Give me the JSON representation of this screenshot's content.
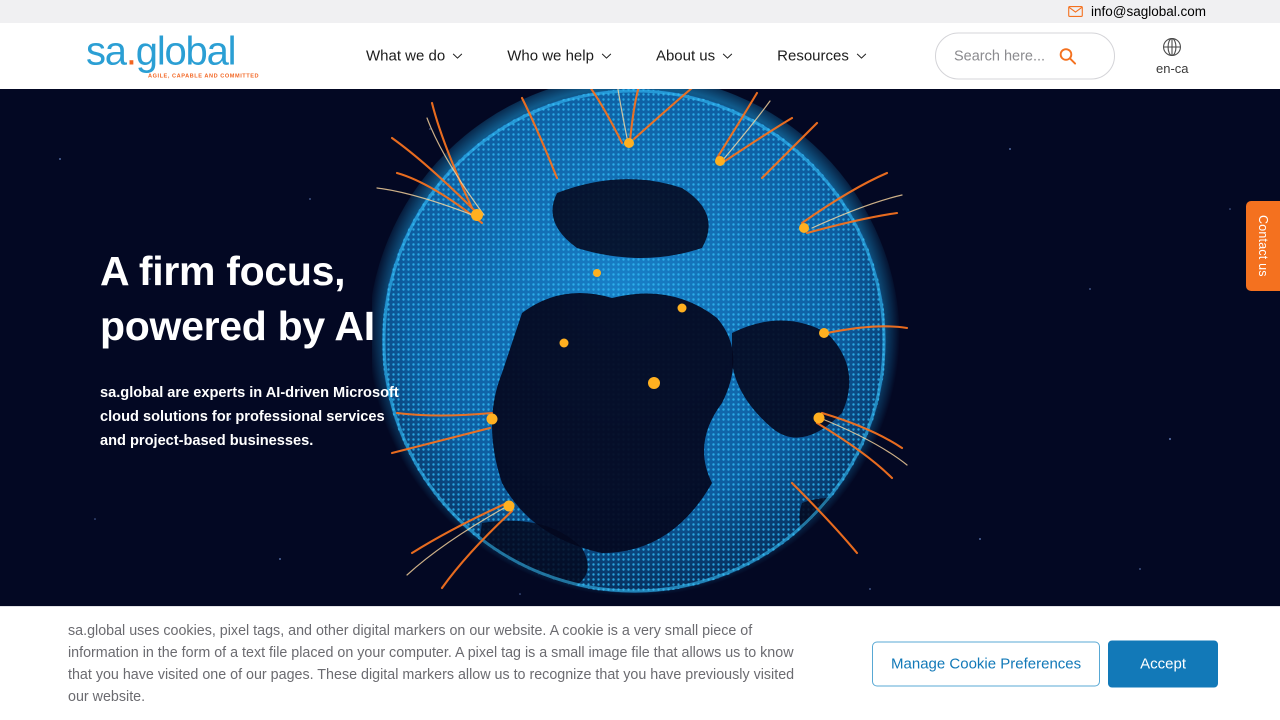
{
  "topbar": {
    "email": "info@saglobal.com",
    "email_icon": "envelope-icon"
  },
  "header": {
    "logo": {
      "text_left": "sa",
      "dot": ".",
      "text_right": "global",
      "tagline": "AGILE, CAPABLE AND COMMITTED",
      "brand_blue": "#2b9fd4",
      "brand_orange": "#f26522"
    },
    "nav": [
      {
        "label": "What we do",
        "icon": "chevron-down-icon"
      },
      {
        "label": "Who we help",
        "icon": "chevron-down-icon"
      },
      {
        "label": "About us",
        "icon": "chevron-down-icon"
      },
      {
        "label": "Resources",
        "icon": "chevron-down-icon"
      }
    ],
    "search": {
      "placeholder": "Search here...",
      "value": "",
      "icon": "search-icon",
      "icon_color": "#f4711f"
    },
    "language": {
      "icon": "globe-icon",
      "label": "en-ca"
    }
  },
  "hero": {
    "title": "A firm focus,\npowered by AI",
    "subtitle": "sa.global are experts in AI-driven Microsoft cloud solutions for professional services and project-based businesses.",
    "background_color": "#030823",
    "globe_color": "#1b9de0",
    "arc_color": "#f4711f",
    "contact_tab": {
      "label": "Contact us",
      "color": "#f4711f"
    }
  },
  "cookie_banner": {
    "text": "sa.global uses cookies, pixel tags, and other digital markers on our website. A cookie is a very small piece of information in the form of a text file placed on your computer. A pixel tag is a small image file that allows us to know that you have visited one of our pages. These digital markers allow us to recognize that you have previously visited our website.",
    "manage_label": "Manage Cookie Preferences",
    "accept_label": "Accept",
    "accent_color": "#1279b8"
  }
}
